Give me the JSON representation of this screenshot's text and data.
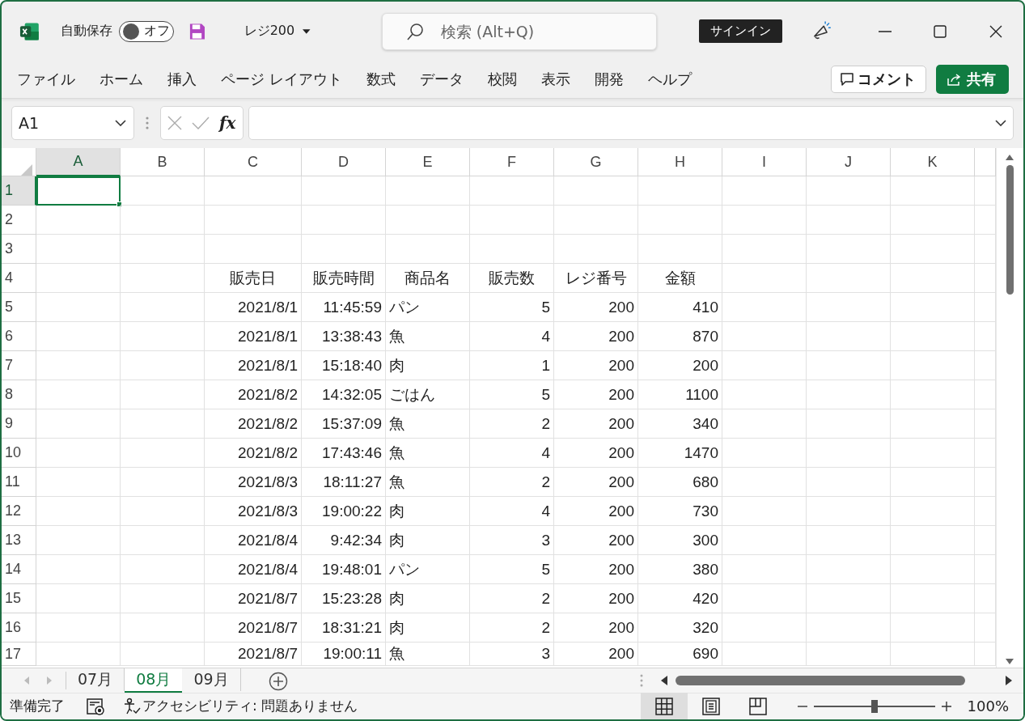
{
  "title_bar": {
    "autosave_label": "自動保存",
    "autosave": {
      "on": false,
      "label": "オフ"
    },
    "file_name": "レジ200",
    "search": {
      "placeholder": "検索 (Alt+Q)"
    },
    "signin": "サインイン"
  },
  "ribbon_tabs": [
    {
      "label": "ファイル"
    },
    {
      "label": "ホーム"
    },
    {
      "label": "挿入"
    },
    {
      "label": "ページ レイアウト"
    },
    {
      "label": "数式"
    },
    {
      "label": "データ"
    },
    {
      "label": "校閲"
    },
    {
      "label": "表示"
    },
    {
      "label": "開発"
    },
    {
      "label": "ヘルプ"
    }
  ],
  "comment_button": "コメント",
  "share_button": "共有",
  "formula_bar": {
    "name_box": "A1",
    "function_label": "fx"
  },
  "columns": [
    {
      "label": "A",
      "selected": true
    },
    {
      "label": "B",
      "selected": false
    },
    {
      "label": "C",
      "selected": false
    },
    {
      "label": "D",
      "selected": false
    },
    {
      "label": "E",
      "selected": false
    },
    {
      "label": "F",
      "selected": false
    },
    {
      "label": "G",
      "selected": false
    },
    {
      "label": "H",
      "selected": false
    },
    {
      "label": "I",
      "selected": false
    },
    {
      "label": "J",
      "selected": false
    },
    {
      "label": "K",
      "selected": false
    }
  ],
  "rows": [
    {
      "number": "1",
      "selected": true
    },
    {
      "number": "2",
      "selected": false
    },
    {
      "number": "3",
      "selected": false
    },
    {
      "number": "4",
      "selected": false,
      "kind": "header",
      "cells": [
        "販売日",
        "販売時間",
        "商品名",
        "販売数",
        "レジ番号",
        "金額"
      ]
    },
    {
      "number": "5",
      "selected": false,
      "kind": "data",
      "cells": [
        "2021/8/1",
        "11:45:59",
        "パン",
        "5",
        "200",
        "410"
      ]
    },
    {
      "number": "6",
      "selected": false,
      "kind": "data",
      "cells": [
        "2021/8/1",
        "13:38:43",
        "魚",
        "4",
        "200",
        "870"
      ]
    },
    {
      "number": "7",
      "selected": false,
      "kind": "data",
      "cells": [
        "2021/8/1",
        "15:18:40",
        "肉",
        "1",
        "200",
        "200"
      ]
    },
    {
      "number": "8",
      "selected": false,
      "kind": "data",
      "cells": [
        "2021/8/2",
        "14:32:05",
        "ごはん",
        "5",
        "200",
        "1100"
      ]
    },
    {
      "number": "9",
      "selected": false,
      "kind": "data",
      "cells": [
        "2021/8/2",
        "15:37:09",
        "魚",
        "2",
        "200",
        "340"
      ]
    },
    {
      "number": "10",
      "selected": false,
      "kind": "data",
      "cells": [
        "2021/8/2",
        "17:43:46",
        "魚",
        "4",
        "200",
        "1470"
      ]
    },
    {
      "number": "11",
      "selected": false,
      "kind": "data",
      "cells": [
        "2021/8/3",
        "18:11:27",
        "魚",
        "2",
        "200",
        "680"
      ]
    },
    {
      "number": "12",
      "selected": false,
      "kind": "data",
      "cells": [
        "2021/8/3",
        "19:00:22",
        "肉",
        "4",
        "200",
        "730"
      ]
    },
    {
      "number": "13",
      "selected": false,
      "kind": "data",
      "cells": [
        "2021/8/4",
        "9:42:34",
        "肉",
        "3",
        "200",
        "300"
      ]
    },
    {
      "number": "14",
      "selected": false,
      "kind": "data",
      "cells": [
        "2021/8/4",
        "19:48:01",
        "パン",
        "5",
        "200",
        "380"
      ]
    },
    {
      "number": "15",
      "selected": false,
      "kind": "data",
      "cells": [
        "2021/8/7",
        "15:23:28",
        "肉",
        "2",
        "200",
        "420"
      ]
    },
    {
      "number": "16",
      "selected": false,
      "kind": "data",
      "cells": [
        "2021/8/7",
        "18:31:21",
        "肉",
        "2",
        "200",
        "320"
      ]
    },
    {
      "number": "17",
      "selected": false,
      "kind": "data",
      "cells": [
        "2021/8/7",
        "19:00:11",
        "魚",
        "3",
        "200",
        "690"
      ]
    }
  ],
  "sheet_tabs": [
    {
      "label": "07月",
      "selected": false
    },
    {
      "label": "08月",
      "selected": true
    },
    {
      "label": "09月",
      "selected": false
    }
  ],
  "status_bar": {
    "status": "準備完了",
    "accessibility": "アクセシビリティ: 問題ありません",
    "views": [
      {
        "kind": "normal",
        "selected": true
      },
      {
        "kind": "page_layout",
        "selected": false
      },
      {
        "kind": "page_break",
        "selected": false
      }
    ],
    "zoom": {
      "level": 0.5,
      "label": "100%"
    }
  }
}
